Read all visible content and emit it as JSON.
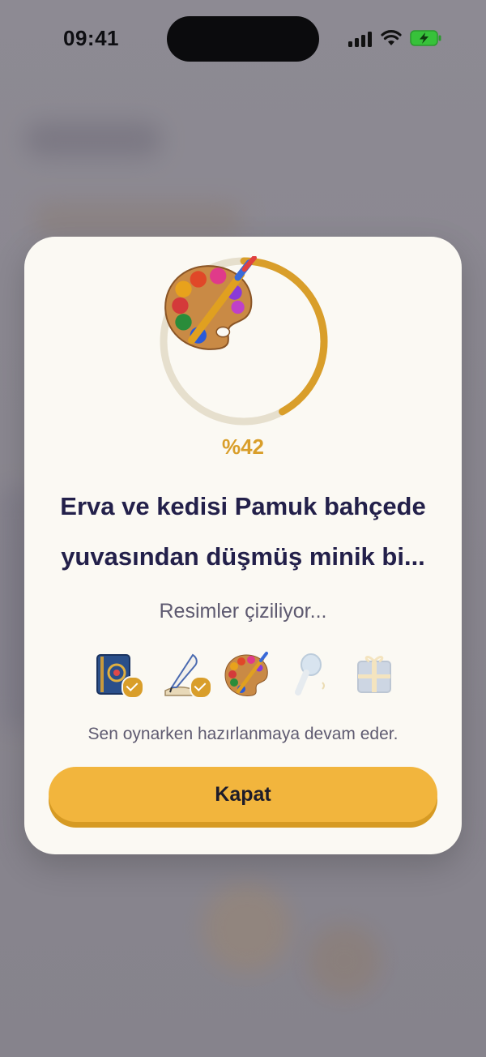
{
  "status_bar": {
    "time": "09:41"
  },
  "modal": {
    "progress_percent": 42,
    "progress_text": "%42",
    "story_title": "Erva ve kedisi Pamuk bahçede yuvasından düşmüş minik bi...",
    "progress_label": "Resimler çiziliyor...",
    "steps": [
      {
        "icon": "storybook-icon",
        "state": "done"
      },
      {
        "icon": "quill-pen-icon",
        "state": "done"
      },
      {
        "icon": "paint-palette-icon",
        "state": "active"
      },
      {
        "icon": "microphone-icon",
        "state": "pending"
      },
      {
        "icon": "gift-box-icon",
        "state": "pending"
      }
    ],
    "info_text": "Sen oynarken hazırlanmaya devam eder.",
    "close_label": "Kapat"
  },
  "colors": {
    "accent": "#d99e2a",
    "button": "#f2b53d",
    "title": "#23204a",
    "modal_bg": "#fbf9f3"
  }
}
